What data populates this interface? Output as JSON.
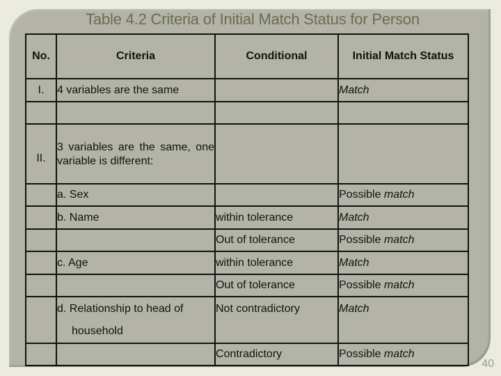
{
  "slide": {
    "title": "Table 4.2 Criteria of Initial Match Status for Person",
    "page_number": "40"
  },
  "table": {
    "headers": [
      "No.",
      "Criteria",
      "Conditional",
      "Initial Match Status"
    ],
    "rows": [
      {
        "no": "I.",
        "criteria": "4 variables are the same",
        "conditional": "",
        "status_prefix": "",
        "status_italic": "Match"
      },
      {
        "no": "",
        "criteria": "",
        "conditional": "",
        "status_prefix": "",
        "status_italic": ""
      },
      {
        "no": "II.",
        "criteria": "3 variables are the same, one variable is different:",
        "conditional": "",
        "status_prefix": "",
        "status_italic": ""
      },
      {
        "no": "",
        "criteria": "a. Sex",
        "conditional": "",
        "status_prefix": "Possible ",
        "status_italic": "match"
      },
      {
        "no": "",
        "criteria": "b. Name",
        "conditional": "within tolerance",
        "status_prefix": "",
        "status_italic": "Match"
      },
      {
        "no": "",
        "criteria": "",
        "conditional": "Out of tolerance",
        "status_prefix": "Possible ",
        "status_italic": "match"
      },
      {
        "no": "",
        "criteria": "c. Age",
        "conditional": "within tolerance",
        "status_prefix": "",
        "status_italic": "Match"
      },
      {
        "no": "",
        "criteria": "",
        "conditional": "Out of tolerance",
        "status_prefix": "Possible ",
        "status_italic": "match"
      },
      {
        "no": "",
        "criteria_line1": "d. Relationship to head of",
        "criteria_line2": "household",
        "conditional": "Not contradictory",
        "status_prefix": "",
        "status_italic": "Match"
      },
      {
        "no": "",
        "criteria": "",
        "conditional": "Contradictory",
        "status_prefix": "Possible ",
        "status_italic": "match"
      }
    ]
  },
  "colors": {
    "background": "#ebebe0",
    "panel": "#b3b4a7",
    "title": "#6a6c54",
    "text": "#111111",
    "page_number": "#9a9b8e"
  }
}
